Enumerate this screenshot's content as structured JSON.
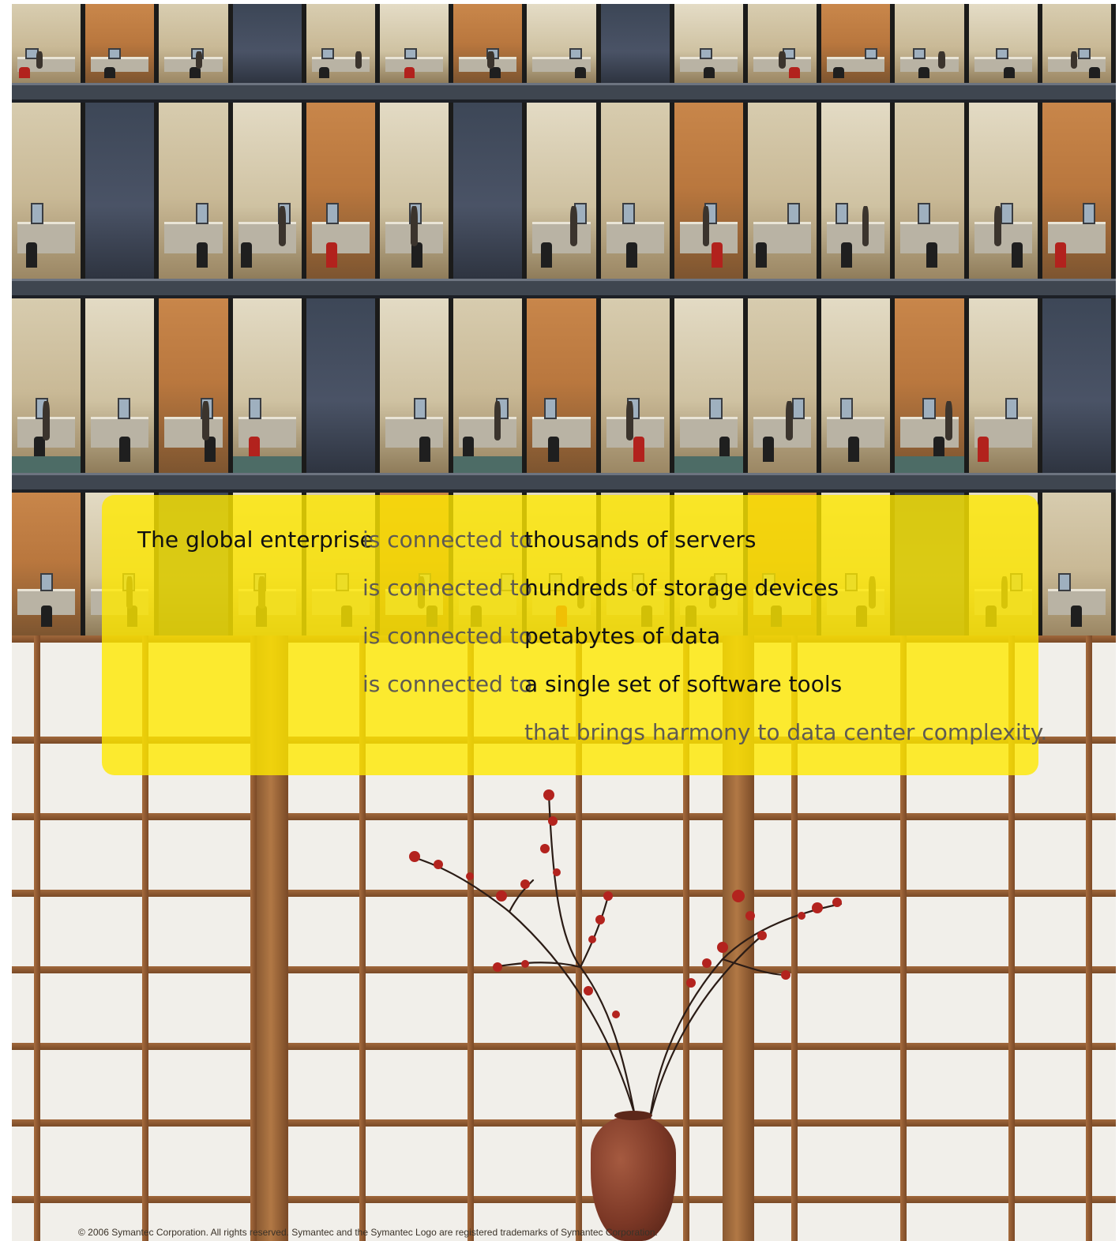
{
  "ad": {
    "colors": {
      "panel": "#FFE800",
      "text_dark": "#111111",
      "text_gray": "#5E5A52"
    },
    "headline": {
      "subject": "The global enterprise",
      "connector": "is connected to",
      "items": [
        "thousands of servers",
        "hundreds of storage devices",
        "petabytes of data",
        "a single set of software tools"
      ],
      "closing": "that brings harmony to data center complexity."
    },
    "footer": {
      "copyright": "© 2006 Symantec Corporation. All rights reserved. Symantec and the Symantec Logo are registered trademarks of Symantec Corporation."
    },
    "icons": {
      "vase": "vase-icon",
      "branch": "blossom-branch-icon"
    }
  }
}
